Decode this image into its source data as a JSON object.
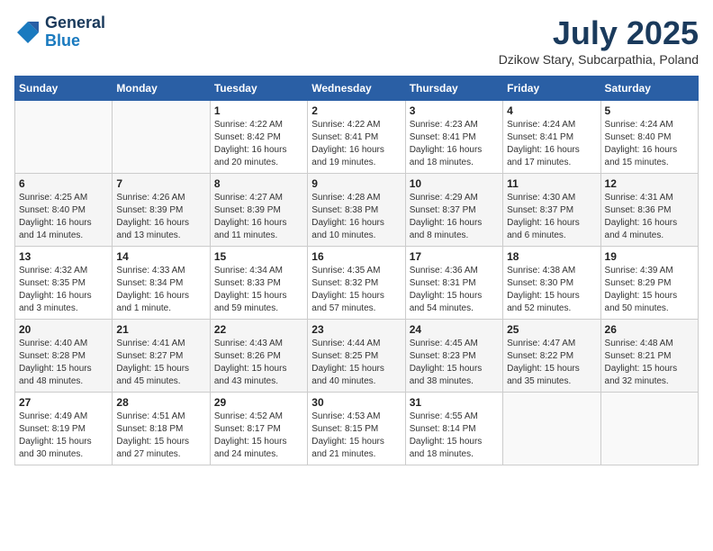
{
  "header": {
    "logo_line1": "General",
    "logo_line2": "Blue",
    "month_title": "July 2025",
    "subtitle": "Dzikow Stary, Subcarpathia, Poland"
  },
  "weekdays": [
    "Sunday",
    "Monday",
    "Tuesday",
    "Wednesday",
    "Thursday",
    "Friday",
    "Saturday"
  ],
  "weeks": [
    [
      {
        "day": "",
        "detail": ""
      },
      {
        "day": "",
        "detail": ""
      },
      {
        "day": "1",
        "detail": "Sunrise: 4:22 AM\nSunset: 8:42 PM\nDaylight: 16 hours\nand 20 minutes."
      },
      {
        "day": "2",
        "detail": "Sunrise: 4:22 AM\nSunset: 8:41 PM\nDaylight: 16 hours\nand 19 minutes."
      },
      {
        "day": "3",
        "detail": "Sunrise: 4:23 AM\nSunset: 8:41 PM\nDaylight: 16 hours\nand 18 minutes."
      },
      {
        "day": "4",
        "detail": "Sunrise: 4:24 AM\nSunset: 8:41 PM\nDaylight: 16 hours\nand 17 minutes."
      },
      {
        "day": "5",
        "detail": "Sunrise: 4:24 AM\nSunset: 8:40 PM\nDaylight: 16 hours\nand 15 minutes."
      }
    ],
    [
      {
        "day": "6",
        "detail": "Sunrise: 4:25 AM\nSunset: 8:40 PM\nDaylight: 16 hours\nand 14 minutes."
      },
      {
        "day": "7",
        "detail": "Sunrise: 4:26 AM\nSunset: 8:39 PM\nDaylight: 16 hours\nand 13 minutes."
      },
      {
        "day": "8",
        "detail": "Sunrise: 4:27 AM\nSunset: 8:39 PM\nDaylight: 16 hours\nand 11 minutes."
      },
      {
        "day": "9",
        "detail": "Sunrise: 4:28 AM\nSunset: 8:38 PM\nDaylight: 16 hours\nand 10 minutes."
      },
      {
        "day": "10",
        "detail": "Sunrise: 4:29 AM\nSunset: 8:37 PM\nDaylight: 16 hours\nand 8 minutes."
      },
      {
        "day": "11",
        "detail": "Sunrise: 4:30 AM\nSunset: 8:37 PM\nDaylight: 16 hours\nand 6 minutes."
      },
      {
        "day": "12",
        "detail": "Sunrise: 4:31 AM\nSunset: 8:36 PM\nDaylight: 16 hours\nand 4 minutes."
      }
    ],
    [
      {
        "day": "13",
        "detail": "Sunrise: 4:32 AM\nSunset: 8:35 PM\nDaylight: 16 hours\nand 3 minutes."
      },
      {
        "day": "14",
        "detail": "Sunrise: 4:33 AM\nSunset: 8:34 PM\nDaylight: 16 hours\nand 1 minute."
      },
      {
        "day": "15",
        "detail": "Sunrise: 4:34 AM\nSunset: 8:33 PM\nDaylight: 15 hours\nand 59 minutes."
      },
      {
        "day": "16",
        "detail": "Sunrise: 4:35 AM\nSunset: 8:32 PM\nDaylight: 15 hours\nand 57 minutes."
      },
      {
        "day": "17",
        "detail": "Sunrise: 4:36 AM\nSunset: 8:31 PM\nDaylight: 15 hours\nand 54 minutes."
      },
      {
        "day": "18",
        "detail": "Sunrise: 4:38 AM\nSunset: 8:30 PM\nDaylight: 15 hours\nand 52 minutes."
      },
      {
        "day": "19",
        "detail": "Sunrise: 4:39 AM\nSunset: 8:29 PM\nDaylight: 15 hours\nand 50 minutes."
      }
    ],
    [
      {
        "day": "20",
        "detail": "Sunrise: 4:40 AM\nSunset: 8:28 PM\nDaylight: 15 hours\nand 48 minutes."
      },
      {
        "day": "21",
        "detail": "Sunrise: 4:41 AM\nSunset: 8:27 PM\nDaylight: 15 hours\nand 45 minutes."
      },
      {
        "day": "22",
        "detail": "Sunrise: 4:43 AM\nSunset: 8:26 PM\nDaylight: 15 hours\nand 43 minutes."
      },
      {
        "day": "23",
        "detail": "Sunrise: 4:44 AM\nSunset: 8:25 PM\nDaylight: 15 hours\nand 40 minutes."
      },
      {
        "day": "24",
        "detail": "Sunrise: 4:45 AM\nSunset: 8:23 PM\nDaylight: 15 hours\nand 38 minutes."
      },
      {
        "day": "25",
        "detail": "Sunrise: 4:47 AM\nSunset: 8:22 PM\nDaylight: 15 hours\nand 35 minutes."
      },
      {
        "day": "26",
        "detail": "Sunrise: 4:48 AM\nSunset: 8:21 PM\nDaylight: 15 hours\nand 32 minutes."
      }
    ],
    [
      {
        "day": "27",
        "detail": "Sunrise: 4:49 AM\nSunset: 8:19 PM\nDaylight: 15 hours\nand 30 minutes."
      },
      {
        "day": "28",
        "detail": "Sunrise: 4:51 AM\nSunset: 8:18 PM\nDaylight: 15 hours\nand 27 minutes."
      },
      {
        "day": "29",
        "detail": "Sunrise: 4:52 AM\nSunset: 8:17 PM\nDaylight: 15 hours\nand 24 minutes."
      },
      {
        "day": "30",
        "detail": "Sunrise: 4:53 AM\nSunset: 8:15 PM\nDaylight: 15 hours\nand 21 minutes."
      },
      {
        "day": "31",
        "detail": "Sunrise: 4:55 AM\nSunset: 8:14 PM\nDaylight: 15 hours\nand 18 minutes."
      },
      {
        "day": "",
        "detail": ""
      },
      {
        "day": "",
        "detail": ""
      }
    ]
  ]
}
